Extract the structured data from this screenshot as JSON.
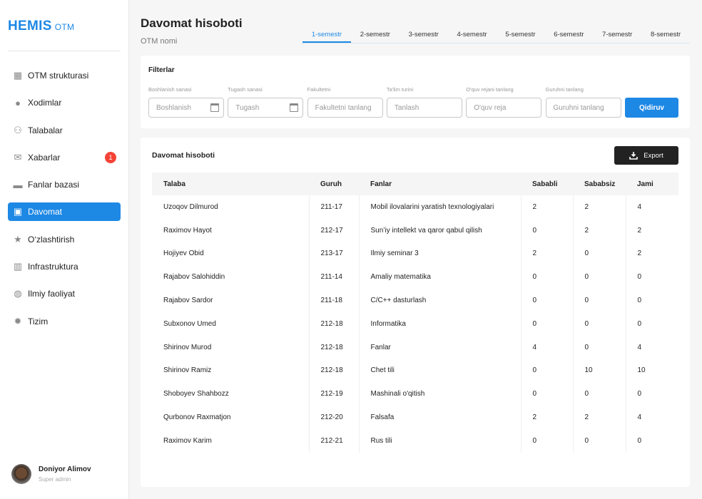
{
  "sidebar": {
    "logo": "HEMIS",
    "logo_sub": "OTM",
    "items": [
      {
        "label": "OTM strukturasi",
        "icon": "building-icon"
      },
      {
        "label": "Xodimlar",
        "icon": "person-icon"
      },
      {
        "label": "Talabalar",
        "icon": "people-icon"
      },
      {
        "label": "Xabarlar",
        "icon": "mail-icon",
        "badge": "1"
      },
      {
        "label": "Fanlar bazasi",
        "icon": "folder-icon"
      },
      {
        "label": "Davomat",
        "icon": "calendar-icon",
        "active": true
      },
      {
        "label": "O‘zlashtirish",
        "icon": "star-icon"
      },
      {
        "label": "Infrastruktura",
        "icon": "office-icon"
      },
      {
        "label": "Ilmiy faoliyat",
        "icon": "globe-icon"
      },
      {
        "label": "Tizim",
        "icon": "gear-icon"
      }
    ],
    "user": {
      "name": "Doniyor Alimov",
      "role": "Super admin"
    }
  },
  "header": {
    "title": "Davomat hisoboti",
    "subtitle": "OTM nomi"
  },
  "tabs": [
    "1-semestr",
    "2-semestr",
    "3-semestr",
    "4-semestr",
    "5-semestr",
    "6-semestr",
    "7-semestr",
    "8-semestr"
  ],
  "filters": {
    "title": "Filterlar",
    "fields": [
      {
        "label": "Boshlanish sanasi",
        "placeholder": "Boshlanish",
        "date": true
      },
      {
        "label": "Tugash sanasi",
        "placeholder": "Tugash",
        "date": true
      },
      {
        "label": "Fakultetni",
        "placeholder": "Fakultetni tanlang"
      },
      {
        "label": "Ta'lim turini",
        "placeholder": "Tanlash"
      },
      {
        "label": "O'quv rejani tanlang",
        "placeholder": "O'quv reja"
      },
      {
        "label": "Guruhni tanlang",
        "placeholder": "Guruhni tanlang"
      }
    ],
    "search_label": "Qidiruv"
  },
  "report": {
    "title": "Davomat hisoboti",
    "export_label": "Export",
    "columns": [
      "Talaba",
      "Guruh",
      "Fanlar",
      "Sababli",
      "Sababsiz",
      "Jami"
    ],
    "rows": [
      [
        "Uzoqov Dilmurod",
        "211-17",
        "Mobil ilovalarini yaratish texnologiyalari",
        "2",
        "2",
        "4"
      ],
      [
        "Raximov Hayot",
        "212-17",
        "Sun’iy intellekt va qaror qabul qilish",
        "0",
        "2",
        "2"
      ],
      [
        "Hojiyev Obid",
        "213-17",
        "Ilmiy seminar 3",
        "2",
        "0",
        "2"
      ],
      [
        "Rajabov Salohiddin",
        "211-14",
        "Amaliy matematika",
        "0",
        "0",
        "0"
      ],
      [
        "Rajabov Sardor",
        "211-18",
        "C/C++ dasturlash",
        "0",
        "0",
        "0"
      ],
      [
        "Subxonov Umed",
        "212-18",
        "Informatika",
        "0",
        "0",
        "0"
      ],
      [
        "Shirinov Murod",
        "212-18",
        "Fanlar",
        "4",
        "0",
        "4"
      ],
      [
        "Shirinov Ramiz",
        "212-18",
        "Chet tili",
        "0",
        "10",
        "10"
      ],
      [
        "Shoboyev Shahbozz",
        "212-19",
        "Mashinali o'qitish",
        "0",
        "0",
        "0"
      ],
      [
        "Qurbonov Raxmatjon",
        "212-20",
        "Falsafa",
        "2",
        "2",
        "4"
      ],
      [
        "Raximov Karim",
        "212-21",
        "Rus tili",
        "0",
        "0",
        "0"
      ]
    ]
  },
  "colors": {
    "accent": "#1e88e5",
    "badge": "#f44336",
    "export": "#222222"
  }
}
